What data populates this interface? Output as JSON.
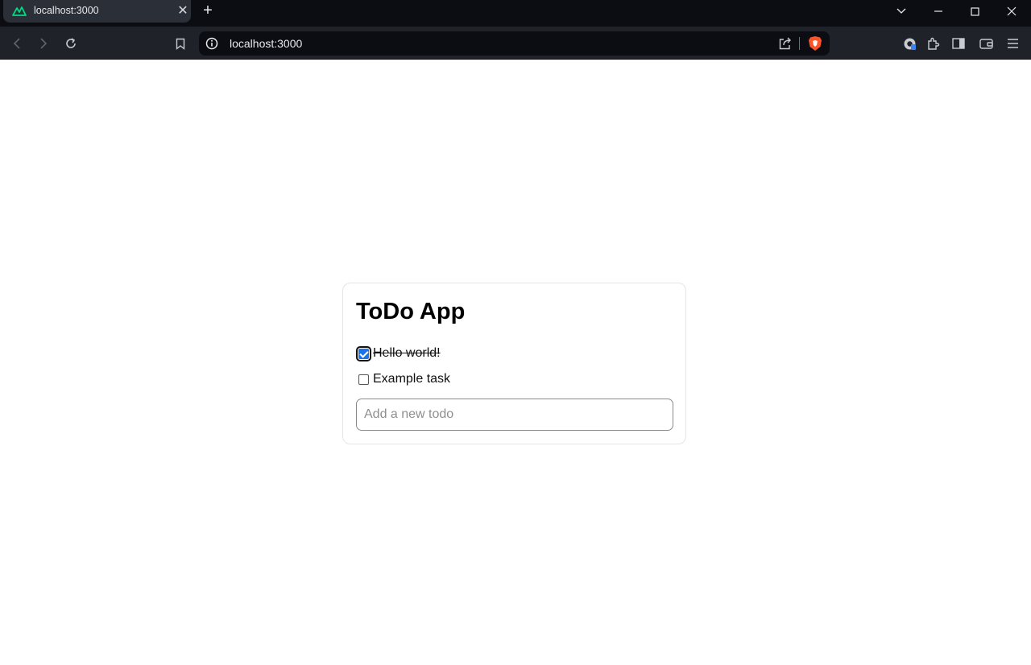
{
  "browser": {
    "tab": {
      "title": "localhost:3000",
      "close_label": "✕"
    },
    "new_tab_label": "+",
    "address": "localhost:3000"
  },
  "app": {
    "title": "ToDo App",
    "todos": [
      {
        "text": "Hello world!",
        "done": true
      },
      {
        "text": "Example task",
        "done": false
      }
    ],
    "input": {
      "placeholder": "Add a new todo",
      "value": ""
    }
  }
}
